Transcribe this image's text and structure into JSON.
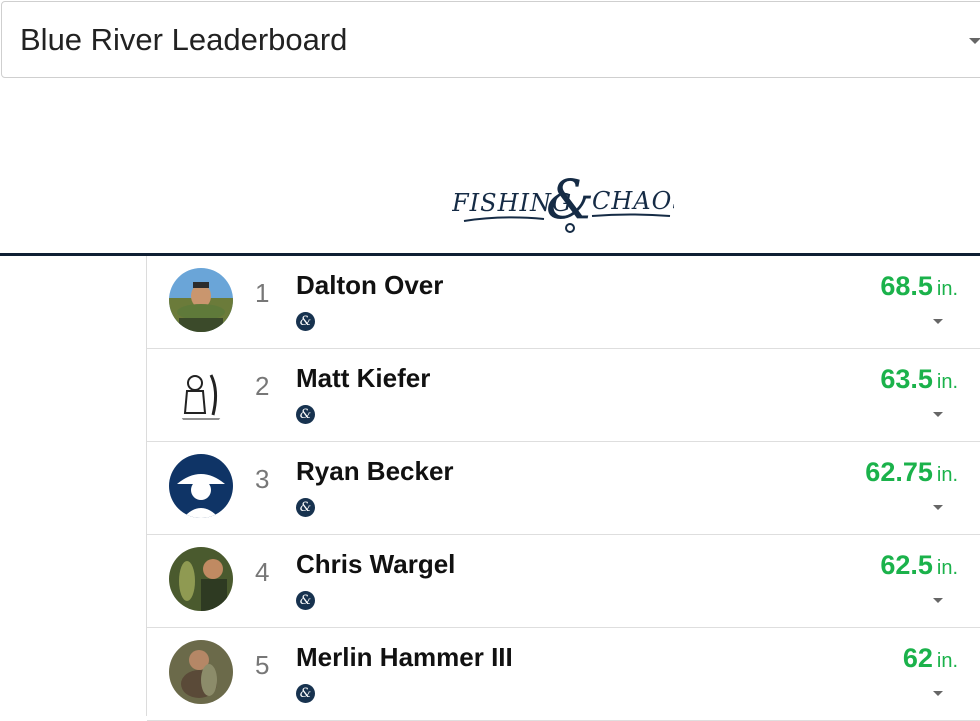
{
  "header": {
    "select_value": "Blue River Leaderboard"
  },
  "logo": {
    "left": "FISHING",
    "amp": "&",
    "right": "CHAOS"
  },
  "leaderboard": {
    "unit": "in.",
    "badge_icon": "ampersand-badge-icon",
    "accent": "#1bb24b",
    "entries": [
      {
        "rank": "1",
        "name": "Dalton Over",
        "score": "68.5"
      },
      {
        "rank": "2",
        "name": "Matt Kiefer",
        "score": "63.5"
      },
      {
        "rank": "3",
        "name": "Ryan Becker",
        "score": "62.75"
      },
      {
        "rank": "4",
        "name": "Chris Wargel",
        "score": "62.5"
      },
      {
        "rank": "5",
        "name": "Merlin Hammer III",
        "score": "62"
      }
    ]
  }
}
